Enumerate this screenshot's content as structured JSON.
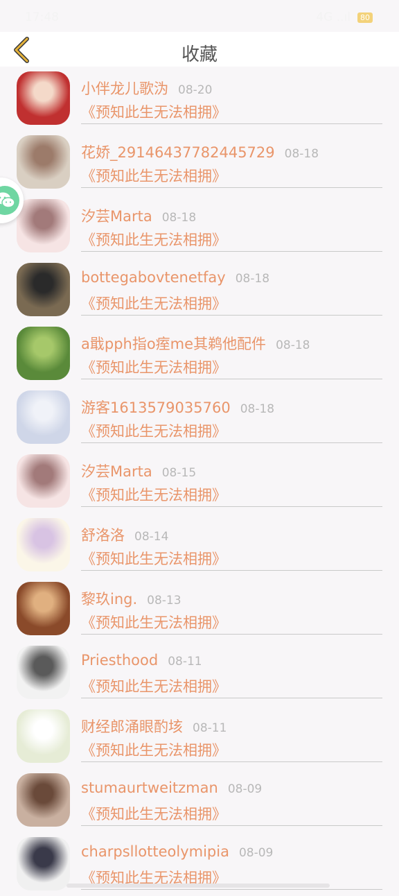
{
  "status": {
    "time": "17:48",
    "signal": "4G ..ıl",
    "battery": "80"
  },
  "header": {
    "title": "收藏"
  },
  "items": [
    {
      "name": "小伴龙儿歌沩",
      "date": "08-20",
      "book": "《预知此生无法相拥》",
      "avatar_colors": [
        "#c03030",
        "#f4d9c9"
      ]
    },
    {
      "name": "花娇_29146437782445729",
      "date": "08-18",
      "book": "《预知此生无法相拥》",
      "avatar_colors": [
        "#d9cfc2",
        "#9c7b6a"
      ]
    },
    {
      "name": "汐芸Marta",
      "date": "08-18",
      "book": "《预知此生无法相拥》",
      "avatar_colors": [
        "#f6e4e4",
        "#a27a7a"
      ]
    },
    {
      "name": "bottegabovtenetfay",
      "date": "08-18",
      "book": "《预知此生无法相拥》",
      "avatar_colors": [
        "#7a6a52",
        "#2a2a2a"
      ]
    },
    {
      "name": "a戢pph指o痓me其鹈他配件",
      "date": "08-18",
      "book": "《预知此生无法相拥》",
      "avatar_colors": [
        "#5a8a3a",
        "#a6c86a"
      ]
    },
    {
      "name": "游客1613579035760",
      "date": "08-18",
      "book": "《预知此生无法相拥》",
      "avatar_colors": [
        "#cfd6e8",
        "#f0f2f8"
      ]
    },
    {
      "name": "汐芸Marta",
      "date": "08-15",
      "book": "《预知此生无法相拥》",
      "avatar_colors": [
        "#f6e4e4",
        "#a27a7a"
      ]
    },
    {
      "name": "舒洛洛",
      "date": "08-14",
      "book": "《预知此生无法相拥》",
      "avatar_colors": [
        "#fbf6e8",
        "#d8c3e3"
      ]
    },
    {
      "name": "黎玖ing.",
      "date": "08-13",
      "book": "《预知此生无法相拥》",
      "avatar_colors": [
        "#8a4a2a",
        "#e0b080"
      ]
    },
    {
      "name": "Priesthood",
      "date": "08-11",
      "book": "《预知此生无法相拥》",
      "avatar_colors": [
        "#f2f2f2",
        "#5a5a5a"
      ]
    },
    {
      "name": "财经郎涌眼酌垓",
      "date": "08-11",
      "book": "《预知此生无法相拥》",
      "avatar_colors": [
        "#e6ecd6",
        "#ffffff"
      ]
    },
    {
      "name": "stumaurtweitzman",
      "date": "08-09",
      "book": "《预知此生无法相拥》",
      "avatar_colors": [
        "#c9b0a0",
        "#6a4a3a"
      ]
    },
    {
      "name": "charpsllotteolymipia",
      "date": "08-09",
      "book": "《预知此生无法相拥》",
      "avatar_colors": [
        "#f0f0f0",
        "#3a3a4a"
      ]
    }
  ],
  "colors": {
    "accent": "#e9956a",
    "date": "#b8b8b8",
    "wechat": "#6fd6a2",
    "back": "#e6b33a"
  },
  "icons": {
    "back": "chevron-left-icon",
    "float": "wechat-icon"
  }
}
